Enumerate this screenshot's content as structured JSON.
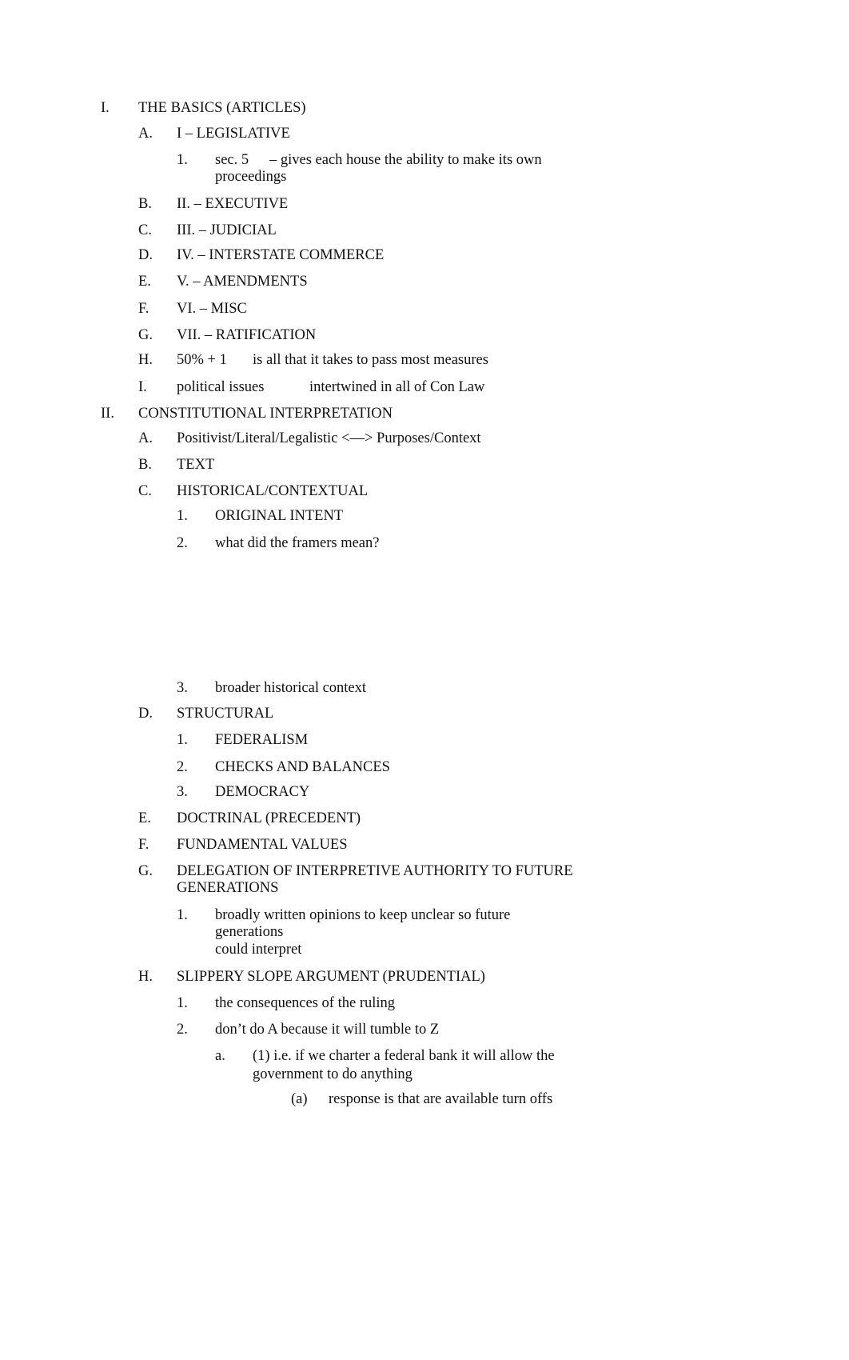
{
  "outline": {
    "I": {
      "marker": "I.",
      "text": "THE BASICS (ARTICLES)"
    },
    "I_A": {
      "marker": "A.",
      "text": "I – LEGISLATIVE"
    },
    "I_A_1": {
      "marker": "1.",
      "text_a": "sec. 5",
      "text_b": "– gives each house the ability to make its own",
      "text_c": "proceedings"
    },
    "I_B": {
      "marker": "B.",
      "text": "II. – EXECUTIVE"
    },
    "I_C": {
      "marker": "C.",
      "text": "III. – JUDICIAL"
    },
    "I_D": {
      "marker": "D.",
      "text": "IV. – INTERSTATE COMMERCE"
    },
    "I_E": {
      "marker": "E.",
      "text": "V. – AMENDMENTS"
    },
    "I_F": {
      "marker": "F.",
      "text": "VI. – MISC"
    },
    "I_G": {
      "marker": "G.",
      "text": "VII. – RATIFICATION"
    },
    "I_H": {
      "marker": "H.",
      "text_a": "50% + 1",
      "text_b": "is all that it takes to pass most measures"
    },
    "I_I": {
      "marker": "I.",
      "text_a": "political issues",
      "text_b": "intertwined in all of Con Law"
    },
    "II": {
      "marker": "II.",
      "text": "CONSTITUTIONAL INTERPRETATION"
    },
    "II_A": {
      "marker": "A.",
      "text": "Positivist/Literal/Legalistic <—> Purposes/Context"
    },
    "II_B": {
      "marker": "B.",
      "text": "TEXT"
    },
    "II_C": {
      "marker": "C.",
      "text": "HISTORICAL/CONTEXTUAL"
    },
    "II_C_1": {
      "marker": "1.",
      "text": "ORIGINAL INTENT"
    },
    "II_C_2": {
      "marker": "2.",
      "text": "what did the framers mean?"
    },
    "II_C_3": {
      "marker": "3.",
      "text": "broader historical context"
    },
    "II_D": {
      "marker": "D.",
      "text": "STRUCTURAL"
    },
    "II_D_1": {
      "marker": "1.",
      "text": "FEDERALISM"
    },
    "II_D_2": {
      "marker": "2.",
      "text": "CHECKS AND BALANCES"
    },
    "II_D_3": {
      "marker": "3.",
      "text": "DEMOCRACY"
    },
    "II_E": {
      "marker": "E.",
      "text": "DOCTRINAL (PRECEDENT)"
    },
    "II_F": {
      "marker": "F.",
      "text": "FUNDAMENTAL VALUES"
    },
    "II_G": {
      "marker": "G.",
      "text_a": "DELEGATION OF INTERPRETIVE AUTHORITY TO FUTURE",
      "text_b": "GENERATIONS"
    },
    "II_G_1": {
      "marker": "1.",
      "text_a": "broadly written opinions to keep unclear so future",
      "text_b": "generations",
      "text_c": "could interpret"
    },
    "II_H": {
      "marker": "H.",
      "text": "SLIPPERY SLOPE ARGUMENT (PRUDENTIAL)"
    },
    "II_H_1": {
      "marker": "1.",
      "text": "the consequences of the ruling"
    },
    "II_H_2": {
      "marker": "2.",
      "text": "don’t do A because it will tumble to Z"
    },
    "II_H_2_a": {
      "marker": "a.",
      "text_a": "(1) i.e. if we charter a federal bank it will allow the",
      "text_b": "government to do anything"
    },
    "II_H_2_a_a": {
      "marker": "(a)",
      "text": "response is that are available turn offs"
    }
  }
}
